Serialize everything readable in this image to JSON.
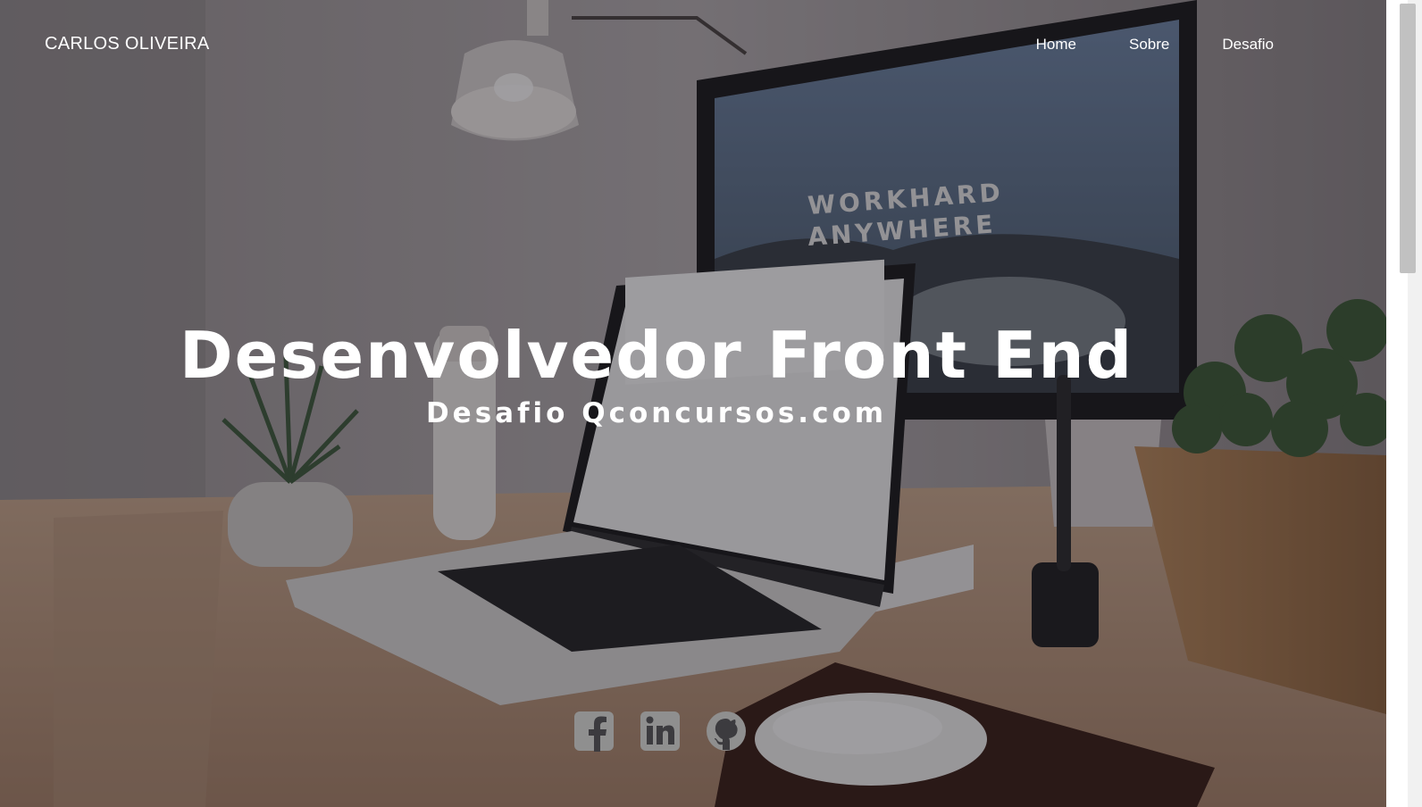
{
  "navbar": {
    "brand": "CARLOS OLIVEIRA",
    "links": [
      {
        "label": "Home"
      },
      {
        "label": "Sobre"
      },
      {
        "label": "Desafio"
      }
    ]
  },
  "hero": {
    "title": "Desenvolvedor Front End",
    "subtitle": "Desafio Qconcursos.com",
    "background_text": [
      "WORKHARD",
      "ANYWHERE"
    ]
  },
  "social": [
    {
      "icon": "facebook-icon"
    },
    {
      "icon": "linkedin-icon"
    },
    {
      "icon": "github-icon"
    }
  ],
  "colors": {
    "text": "#ffffff",
    "overlay": "#14121866",
    "icon": "#8a8a8a",
    "scroll_thumb": "#c1c1c1"
  }
}
